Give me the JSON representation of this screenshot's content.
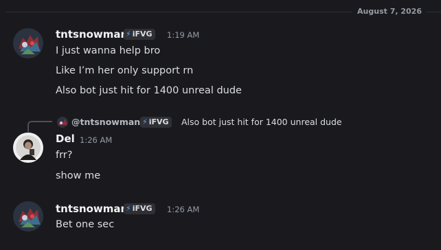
{
  "date_divider": "August 7, 2026",
  "messages": [
    {
      "author": "tntsnowman",
      "tag": "iFVG",
      "time": "1:19 AM",
      "lines": [
        "I just wanna help bro",
        "Like I’m her only support rn",
        "Also bot just hit for 1400 unreal dude"
      ]
    },
    {
      "reply": {
        "author": "@tntsnowman",
        "tag": "iFVG",
        "text": "Also bot just hit for 1400 unreal dude"
      },
      "author": "Del",
      "time": "1:26 AM",
      "lines": [
        "frr?",
        "show me"
      ]
    },
    {
      "author": "tntsnowman",
      "tag": "iFVG",
      "time": "1:26 AM",
      "lines": [
        "Bet one sec"
      ]
    }
  ],
  "colors": {
    "background": "#1a1a1e",
    "username": "#f2f3f5",
    "message_text": "#dbdee1",
    "muted": "#949ba4",
    "tag_bolt": "#5aa9ff"
  }
}
